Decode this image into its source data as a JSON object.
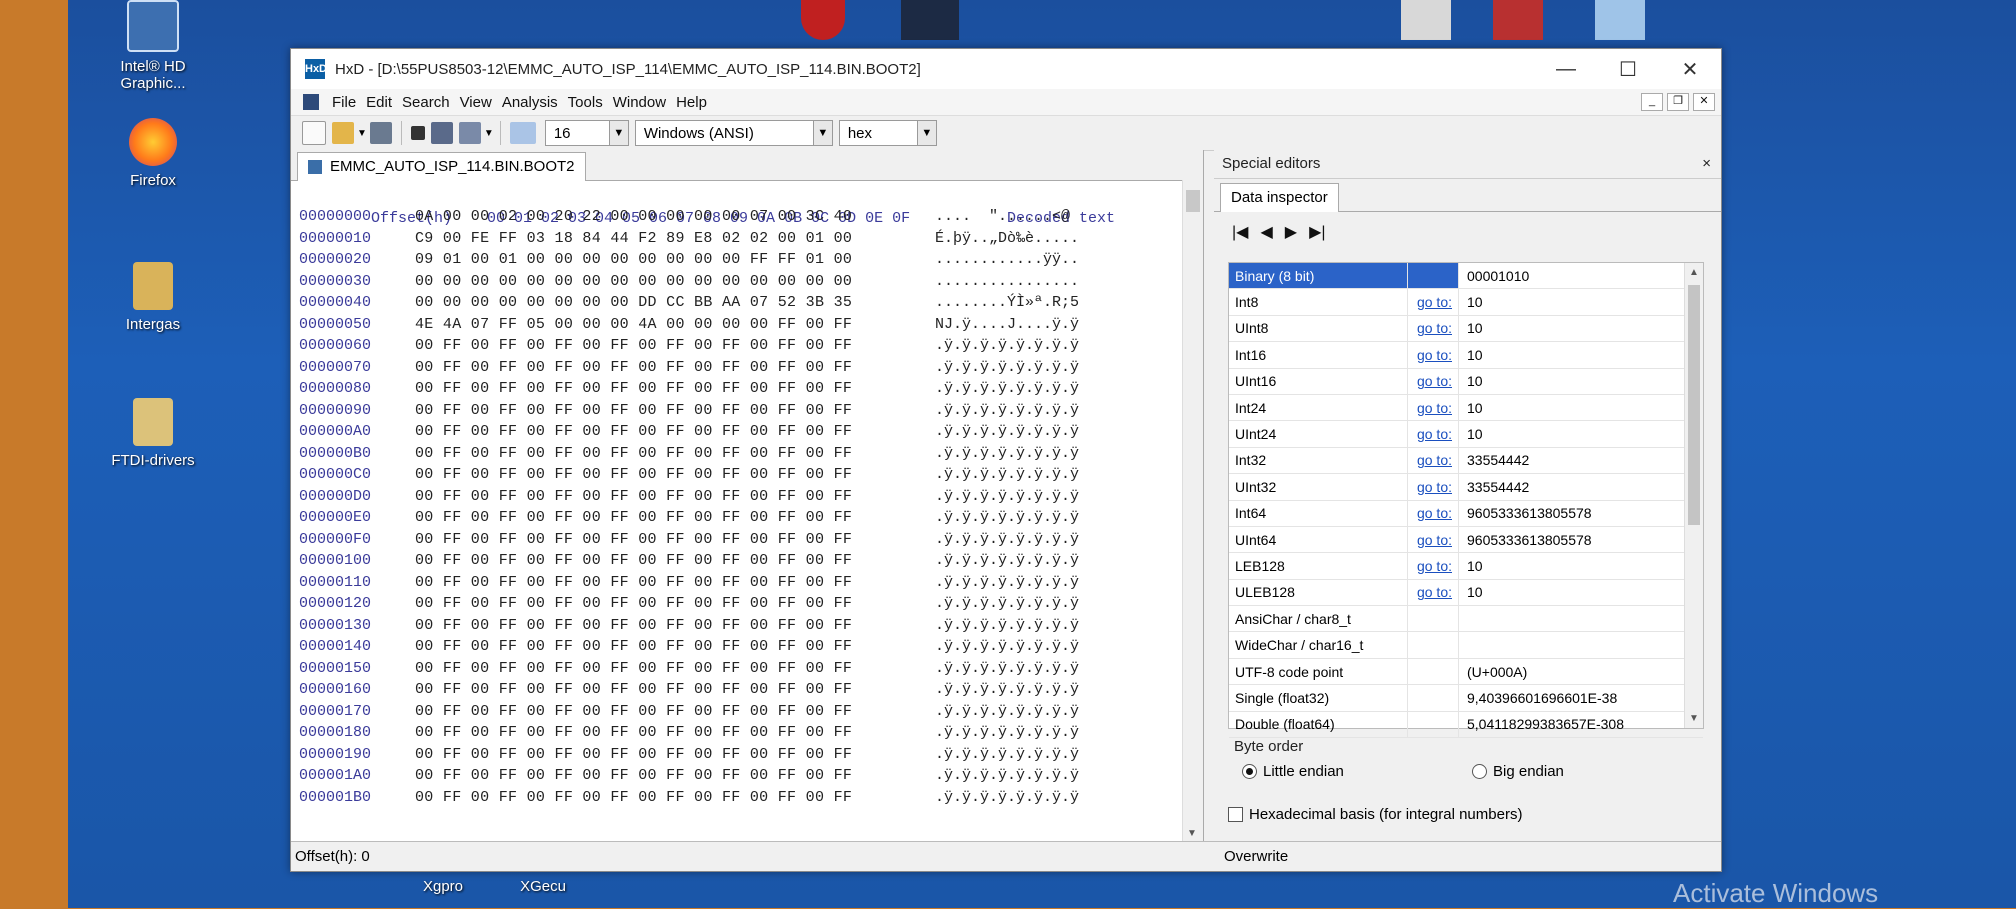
{
  "desktop": {
    "icons": [
      {
        "label": "Intel® HD\nGraphic..."
      },
      {
        "label": "Firefox"
      },
      {
        "label": "Intergas"
      },
      {
        "label": "FTDI-drivers"
      },
      {
        "label": "Xgpro"
      },
      {
        "label": "XGecu"
      }
    ],
    "watermark": "Activate Windows"
  },
  "window": {
    "app_icon": "HxD",
    "title": "HxD - [D:\\55PUS8503-12\\EMMC_AUTO_ISP_114\\EMMC_AUTO_ISP_114.BIN.BOOT2]",
    "minimize": "—",
    "maximize": "☐",
    "close": "✕"
  },
  "menu": [
    "File",
    "Edit",
    "Search",
    "View",
    "Analysis",
    "Tools",
    "Window",
    "Help"
  ],
  "toolbar": {
    "bytes_per_row": "16",
    "charset": "Windows (ANSI)",
    "mode": "hex"
  },
  "editor": {
    "tab_label": "EMMC_AUTO_ISP_114.BIN.BOOT2",
    "header": {
      "offset": "Offset(h)",
      "columns": "00 01 02 03 04 05 06 07 08 09 0A 0B 0C 0D 0E 0F",
      "decoded": "Decoded text"
    },
    "rows": [
      {
        "off": "00000000",
        "hex": "0A 00 00 02 00 20 22 00 00 00 00 00 07 00 3C 40",
        "dec": "....  \"......<@"
      },
      {
        "off": "00000010",
        "hex": "C9 00 FE FF 03 18 84 44 F2 89 E8 02 02 00 01 00",
        "dec": "É.þÿ..„Dò‰è....."
      },
      {
        "off": "00000020",
        "hex": "09 01 00 01 00 00 00 00 00 00 00 00 FF FF 01 00",
        "dec": "............ÿÿ.."
      },
      {
        "off": "00000030",
        "hex": "00 00 00 00 00 00 00 00 00 00 00 00 00 00 00 00",
        "dec": "................"
      },
      {
        "off": "00000040",
        "hex": "00 00 00 00 00 00 00 00 DD CC BB AA 07 52 3B 35",
        "dec": "........ÝÌ»ª.R;5"
      },
      {
        "off": "00000050",
        "hex": "4E 4A 07 FF 05 00 00 00 4A 00 00 00 00 FF 00 FF",
        "dec": "NJ.ÿ....J....ÿ.ÿ"
      },
      {
        "off": "00000060",
        "hex": "00 FF 00 FF 00 FF 00 FF 00 FF 00 FF 00 FF 00 FF",
        "dec": ".ÿ.ÿ.ÿ.ÿ.ÿ.ÿ.ÿ.ÿ"
      },
      {
        "off": "00000070",
        "hex": "00 FF 00 FF 00 FF 00 FF 00 FF 00 FF 00 FF 00 FF",
        "dec": ".ÿ.ÿ.ÿ.ÿ.ÿ.ÿ.ÿ.ÿ"
      },
      {
        "off": "00000080",
        "hex": "00 FF 00 FF 00 FF 00 FF 00 FF 00 FF 00 FF 00 FF",
        "dec": ".ÿ.ÿ.ÿ.ÿ.ÿ.ÿ.ÿ.ÿ"
      },
      {
        "off": "00000090",
        "hex": "00 FF 00 FF 00 FF 00 FF 00 FF 00 FF 00 FF 00 FF",
        "dec": ".ÿ.ÿ.ÿ.ÿ.ÿ.ÿ.ÿ.ÿ"
      },
      {
        "off": "000000A0",
        "hex": "00 FF 00 FF 00 FF 00 FF 00 FF 00 FF 00 FF 00 FF",
        "dec": ".ÿ.ÿ.ÿ.ÿ.ÿ.ÿ.ÿ.ÿ"
      },
      {
        "off": "000000B0",
        "hex": "00 FF 00 FF 00 FF 00 FF 00 FF 00 FF 00 FF 00 FF",
        "dec": ".ÿ.ÿ.ÿ.ÿ.ÿ.ÿ.ÿ.ÿ"
      },
      {
        "off": "000000C0",
        "hex": "00 FF 00 FF 00 FF 00 FF 00 FF 00 FF 00 FF 00 FF",
        "dec": ".ÿ.ÿ.ÿ.ÿ.ÿ.ÿ.ÿ.ÿ"
      },
      {
        "off": "000000D0",
        "hex": "00 FF 00 FF 00 FF 00 FF 00 FF 00 FF 00 FF 00 FF",
        "dec": ".ÿ.ÿ.ÿ.ÿ.ÿ.ÿ.ÿ.ÿ"
      },
      {
        "off": "000000E0",
        "hex": "00 FF 00 FF 00 FF 00 FF 00 FF 00 FF 00 FF 00 FF",
        "dec": ".ÿ.ÿ.ÿ.ÿ.ÿ.ÿ.ÿ.ÿ"
      },
      {
        "off": "000000F0",
        "hex": "00 FF 00 FF 00 FF 00 FF 00 FF 00 FF 00 FF 00 FF",
        "dec": ".ÿ.ÿ.ÿ.ÿ.ÿ.ÿ.ÿ.ÿ"
      },
      {
        "off": "00000100",
        "hex": "00 FF 00 FF 00 FF 00 FF 00 FF 00 FF 00 FF 00 FF",
        "dec": ".ÿ.ÿ.ÿ.ÿ.ÿ.ÿ.ÿ.ÿ"
      },
      {
        "off": "00000110",
        "hex": "00 FF 00 FF 00 FF 00 FF 00 FF 00 FF 00 FF 00 FF",
        "dec": ".ÿ.ÿ.ÿ.ÿ.ÿ.ÿ.ÿ.ÿ"
      },
      {
        "off": "00000120",
        "hex": "00 FF 00 FF 00 FF 00 FF 00 FF 00 FF 00 FF 00 FF",
        "dec": ".ÿ.ÿ.ÿ.ÿ.ÿ.ÿ.ÿ.ÿ"
      },
      {
        "off": "00000130",
        "hex": "00 FF 00 FF 00 FF 00 FF 00 FF 00 FF 00 FF 00 FF",
        "dec": ".ÿ.ÿ.ÿ.ÿ.ÿ.ÿ.ÿ.ÿ"
      },
      {
        "off": "00000140",
        "hex": "00 FF 00 FF 00 FF 00 FF 00 FF 00 FF 00 FF 00 FF",
        "dec": ".ÿ.ÿ.ÿ.ÿ.ÿ.ÿ.ÿ.ÿ"
      },
      {
        "off": "00000150",
        "hex": "00 FF 00 FF 00 FF 00 FF 00 FF 00 FF 00 FF 00 FF",
        "dec": ".ÿ.ÿ.ÿ.ÿ.ÿ.ÿ.ÿ.ÿ"
      },
      {
        "off": "00000160",
        "hex": "00 FF 00 FF 00 FF 00 FF 00 FF 00 FF 00 FF 00 FF",
        "dec": ".ÿ.ÿ.ÿ.ÿ.ÿ.ÿ.ÿ.ÿ"
      },
      {
        "off": "00000170",
        "hex": "00 FF 00 FF 00 FF 00 FF 00 FF 00 FF 00 FF 00 FF",
        "dec": ".ÿ.ÿ.ÿ.ÿ.ÿ.ÿ.ÿ.ÿ"
      },
      {
        "off": "00000180",
        "hex": "00 FF 00 FF 00 FF 00 FF 00 FF 00 FF 00 FF 00 FF",
        "dec": ".ÿ.ÿ.ÿ.ÿ.ÿ.ÿ.ÿ.ÿ"
      },
      {
        "off": "00000190",
        "hex": "00 FF 00 FF 00 FF 00 FF 00 FF 00 FF 00 FF 00 FF",
        "dec": ".ÿ.ÿ.ÿ.ÿ.ÿ.ÿ.ÿ.ÿ"
      },
      {
        "off": "000001A0",
        "hex": "00 FF 00 FF 00 FF 00 FF 00 FF 00 FF 00 FF 00 FF",
        "dec": ".ÿ.ÿ.ÿ.ÿ.ÿ.ÿ.ÿ.ÿ"
      },
      {
        "off": "000001B0",
        "hex": "00 FF 00 FF 00 FF 00 FF 00 FF 00 FF 00 FF 00 FF",
        "dec": ".ÿ.ÿ.ÿ.ÿ.ÿ.ÿ.ÿ.ÿ"
      }
    ]
  },
  "special_editors": {
    "title": "Special editors",
    "close": "×",
    "tab": "Data inspector",
    "nav": [
      "|◀",
      "◀",
      "▶",
      "▶|"
    ],
    "goto_label": "go to:",
    "rows": [
      {
        "name": "Binary (8 bit)",
        "goto": false,
        "value": "00001010"
      },
      {
        "name": "Int8",
        "goto": true,
        "value": "10"
      },
      {
        "name": "UInt8",
        "goto": true,
        "value": "10"
      },
      {
        "name": "Int16",
        "goto": true,
        "value": "10"
      },
      {
        "name": "UInt16",
        "goto": true,
        "value": "10"
      },
      {
        "name": "Int24",
        "goto": true,
        "value": "10"
      },
      {
        "name": "UInt24",
        "goto": true,
        "value": "10"
      },
      {
        "name": "Int32",
        "goto": true,
        "value": "33554442"
      },
      {
        "name": "UInt32",
        "goto": true,
        "value": "33554442"
      },
      {
        "name": "Int64",
        "goto": true,
        "value": "9605333613805578"
      },
      {
        "name": "UInt64",
        "goto": true,
        "value": "9605333613805578"
      },
      {
        "name": "LEB128",
        "goto": true,
        "value": "10"
      },
      {
        "name": "ULEB128",
        "goto": true,
        "value": "10"
      },
      {
        "name": "AnsiChar / char8_t",
        "goto": false,
        "value": ""
      },
      {
        "name": "WideChar / char16_t",
        "goto": false,
        "value": ""
      },
      {
        "name": "UTF-8 code point",
        "goto": false,
        "value": " (U+000A)"
      },
      {
        "name": "Single (float32)",
        "goto": false,
        "value": "9,40396601696601E-38"
      },
      {
        "name": "Double (float64)",
        "goto": false,
        "value": "5,04118299383657E-308"
      }
    ],
    "byte_order_label": "Byte order",
    "little_endian": "Little endian",
    "big_endian": "Big endian",
    "hex_basis": "Hexadecimal basis (for integral numbers)"
  },
  "status": {
    "offset": "Offset(h): 0",
    "mode": "Overwrite"
  }
}
